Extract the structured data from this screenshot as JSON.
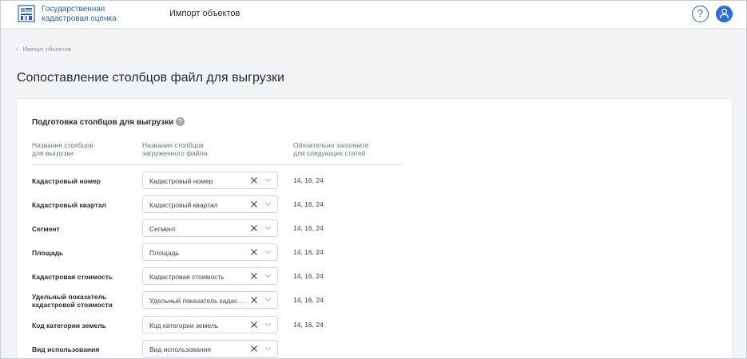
{
  "header": {
    "logo_line1": "Государственная",
    "logo_line2": "кадастровая оценка",
    "title": "Импорт объектов",
    "help_label": "?"
  },
  "breadcrumb": {
    "label": "Импорт объектов"
  },
  "page_title": "Сопоставление столбцов файл для выгрузки",
  "section": {
    "title": "Подготовка столбцов для выгрузки",
    "info_label": "?"
  },
  "columns": {
    "c1_line1": "Названия столбцов",
    "c1_line2": "для выгрузки",
    "c2_line1": "Названия столбцов",
    "c2_line2": "загруженного файла",
    "c3_line1": "Обязательно заполните",
    "c3_line2": "для следующих статей"
  },
  "rows": [
    {
      "label": "Кадастровый номер",
      "value": "Кадастровый номер",
      "note": "14, 16, 24"
    },
    {
      "label": "Кадастровый квартал",
      "value": "Кадастровый квартал",
      "note": "14, 16, 24"
    },
    {
      "label": "Сегмент",
      "value": "Сегмент",
      "note": "14, 16, 24"
    },
    {
      "label": "Площадь",
      "value": "Площадь",
      "note": "14, 16, 24"
    },
    {
      "label": "Кадастровая стоимость",
      "value": "Кадастровая стоимость",
      "note": "14, 16, 24"
    },
    {
      "label_line1": "Удельный показатель",
      "label_line2": "кадастровой стоимости",
      "value": "Удельный показатель кадастровой стоимости",
      "note": "14, 16, 24"
    },
    {
      "label": "Код категории земель",
      "value": "Код категории земель",
      "note": "14, 16, 24"
    },
    {
      "label": "Вид использования",
      "value": "Вид использования",
      "note": ""
    }
  ],
  "colors": {
    "brand": "#2f5fa8",
    "avatar": "#2e6dd6",
    "background": "#f2f3f5"
  }
}
